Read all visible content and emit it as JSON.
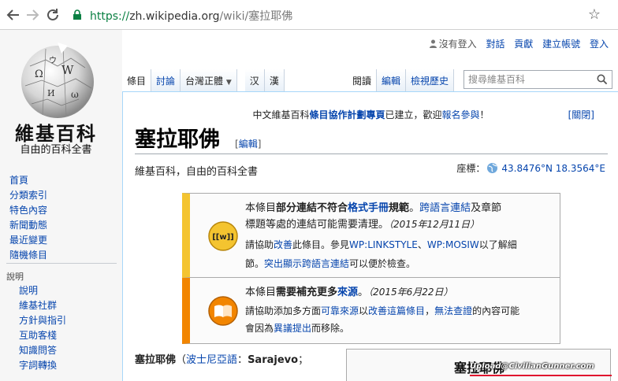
{
  "browser": {
    "url_scheme": "https://",
    "url_host": "zh.wikipedia.org",
    "url_path": "/wiki/塞拉耶佛"
  },
  "personal": {
    "not_logged_in": "沒有登入",
    "talk": "對話",
    "contributions": "貢獻",
    "create_account": "建立帳號",
    "login": "登入"
  },
  "logo": {
    "title": "維基百科",
    "subtitle": "自由的百科全書"
  },
  "sidebar": {
    "nav": [
      "首頁",
      "分類索引",
      "特色內容",
      "新聞動態",
      "最近變更",
      "隨機條目"
    ],
    "help_heading": "說明",
    "help": [
      "說明",
      "維基社群",
      "方針與指引",
      "互助客棧",
      "知識問答",
      "字詞轉換"
    ]
  },
  "tabs": {
    "article": "條目",
    "talk": "討論",
    "variant": "台灣正體",
    "han_simplified": "汉",
    "han_traditional": "漢",
    "read": "閱讀",
    "edit": "編輯",
    "history": "檢視歷史"
  },
  "search": {
    "placeholder": "搜尋維基百科"
  },
  "notice": {
    "prefix": "中文維基百科",
    "link": "條目協作計劃專頁",
    "suffix": "已建立，歡迎",
    "link2": "報名參與",
    "end": "！",
    "close": "[關閉]"
  },
  "article": {
    "title": "塞拉耶佛",
    "edit": "編輯",
    "tagline": "維基百科，自由的百科全書",
    "coords_label": "座標：",
    "coords_value": "43.8476°N 18.3564°E"
  },
  "mbox_style": {
    "l1_a": "本條目",
    "l1_b": "部分連結不符合",
    "l1_link": "格式手冊",
    "l1_c": "規範",
    "l1_d": "。",
    "l1_link2": "跨語言連結",
    "l1_e": "及章節",
    "l2_a": "標題等處的連結可能需要清理。",
    "l2_date": "（2015年12月11日）",
    "l3_a": "請協助",
    "l3_link": "改善",
    "l3_b": "此條目。參見",
    "l3_link2": "WP:LINKSTYLE",
    "l3_c": "、",
    "l3_link3": "WP:MOSIW",
    "l3_d": "以了解細",
    "l4_a": "節。",
    "l4_link": "突出顯示跨語言連結",
    "l4_b": "可以便於檢查。",
    "icon_label": "[[w]]"
  },
  "mbox_refs": {
    "l1_a": "本條目",
    "l1_b": "需要補充更多",
    "l1_link": "來源",
    "l1_c": "。",
    "l1_date": "（2015年6月22日）",
    "l2_a": "請協助添加多方面",
    "l2_link": "可靠來源",
    "l2_b": "以",
    "l2_link2": "改善這篇條目",
    "l2_c": "，",
    "l2_link3": "無法查證",
    "l2_d": "的內容可能",
    "l3_a": "會因為",
    "l3_link": "異議提出",
    "l3_b": "而移除。"
  },
  "lede": {
    "bold": "塞拉耶佛",
    "open": "（",
    "link": "波士尼亞語",
    "colon": "：",
    "name": "Sarajevo",
    "semi": "；"
  },
  "infobox": {
    "title": "塞拉耶佛"
  },
  "watermark": "Upload@CivilianGunner.com",
  "colors": {
    "link": "#0645ad",
    "style_bar": "#f4c430",
    "refs_bar": "#f28500"
  }
}
